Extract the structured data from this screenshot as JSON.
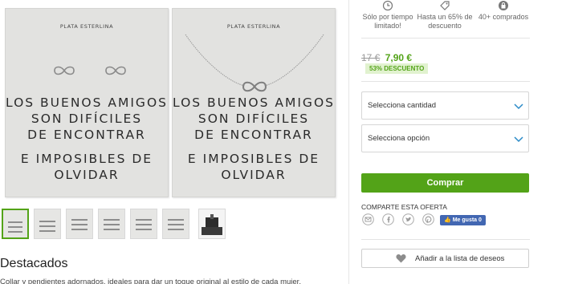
{
  "product": {
    "cards": [
      {
        "brand": "PLATA ESTERLINA",
        "quote_lines": [
          "LOS BUENOS AMIGOS",
          "SON DIFÍCILES",
          "DE ENCONTRAR"
        ],
        "quote_lines_2": [
          "E IMPOSIBLES DE",
          "OLVIDAR"
        ]
      },
      {
        "brand": "PLATA ESTERLINA",
        "quote_lines": [
          "LOS BUENOS AMIGOS",
          "SON DIFÍCILES",
          "DE ENCONTRAR"
        ],
        "quote_lines_2": [
          "E IMPOSIBLES DE",
          "OLVIDAR"
        ]
      }
    ],
    "section_title": "Destacados",
    "section_text": "Collar y pendientes adornados, ideales para dar un toque original al estilo de cada mujer."
  },
  "deal": {
    "badges": [
      {
        "icon": "clock-icon",
        "label_1": "Sólo por tiempo",
        "label_2": "limitado!"
      },
      {
        "icon": "tag-icon",
        "label_1": "Hasta un 65% de",
        "label_2": "descuento"
      },
      {
        "icon": "bag-icon",
        "label_1": "40+ comprados",
        "label_2": ""
      }
    ],
    "old_price": "17 €",
    "new_price": "7,90 €",
    "discount": "53% DESCUENTO",
    "select_quantity": "Selecciona cantidad",
    "select_option": "Selecciona opción",
    "buy_label": "Comprar",
    "share_title": "COMPARTE ESTA OFERTA",
    "share_icons": [
      "email-icon",
      "facebook-icon",
      "twitter-icon",
      "pinterest-icon"
    ],
    "fb_like": "Me gusta 0",
    "wishlist_label": "Añadir a la lista de deseos"
  },
  "colors": {
    "accent": "#53a318",
    "discount_bg": "#e1f2cf",
    "facebook": "#4267b2",
    "chevron": "#2a8ac7"
  }
}
